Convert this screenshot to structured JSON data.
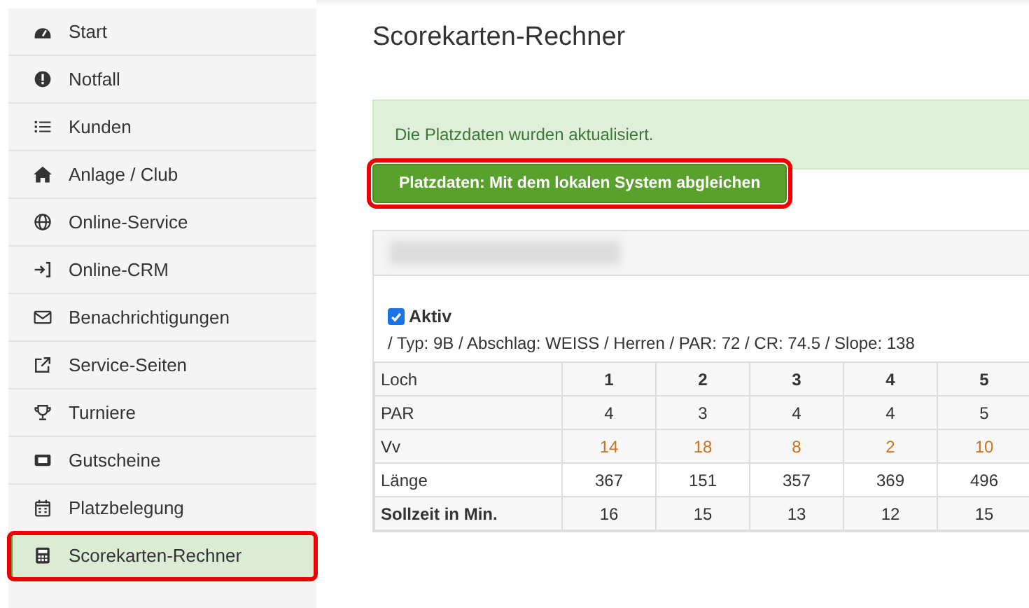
{
  "sidebar": {
    "items": [
      {
        "label": "Start",
        "kind": "dashboard",
        "selected": false,
        "highlighted": false
      },
      {
        "label": "Notfall",
        "kind": "alert",
        "selected": false,
        "highlighted": false
      },
      {
        "label": "Kunden",
        "kind": "list",
        "selected": false,
        "highlighted": false
      },
      {
        "label": "Anlage / Club",
        "kind": "home",
        "selected": false,
        "highlighted": false
      },
      {
        "label": "Online-Service",
        "kind": "globe",
        "selected": false,
        "highlighted": false
      },
      {
        "label": "Online-CRM",
        "kind": "login",
        "selected": false,
        "highlighted": false
      },
      {
        "label": "Benachrichtigungen",
        "kind": "mail",
        "selected": false,
        "highlighted": false
      },
      {
        "label": "Service-Seiten",
        "kind": "external",
        "selected": false,
        "highlighted": false
      },
      {
        "label": "Turniere",
        "kind": "trophy",
        "selected": false,
        "highlighted": false
      },
      {
        "label": "Gutscheine",
        "kind": "ticket",
        "selected": false,
        "highlighted": false
      },
      {
        "label": "Platzbelegung",
        "kind": "calendar",
        "selected": false,
        "highlighted": false
      },
      {
        "label": "Scorekarten-Rechner",
        "kind": "calculator",
        "selected": true,
        "highlighted": true
      }
    ]
  },
  "page_title": "Scorekarten-Rechner",
  "alert": "Die Platzdaten wurden aktualisiert.",
  "sync_button": {
    "label": "Platzdaten: Mit dem lokalen System abgleichen",
    "highlighted": true
  },
  "course": {
    "active": {
      "label": "Aktiv",
      "checked": true
    },
    "details": "/ Typ: 9B / Abschlag: WEISS / Herren / PAR: 72 / CR: 74.5 / Slope: 138",
    "table": {
      "rows": [
        {
          "kind": "header",
          "label": "Loch",
          "cells": [
            "1",
            "2",
            "3",
            "4",
            "5"
          ]
        },
        {
          "kind": "plain",
          "label": "PAR",
          "cells": [
            "4",
            "3",
            "4",
            "4",
            "5"
          ]
        },
        {
          "kind": "accent",
          "label": "Vv",
          "cells": [
            "14",
            "18",
            "8",
            "2",
            "10"
          ]
        },
        {
          "kind": "plain",
          "label": "Länge",
          "cells": [
            "367",
            "151",
            "357",
            "369",
            "496"
          ]
        },
        {
          "kind": "bold",
          "label": "Sollzeit in Min.",
          "cells": [
            "16",
            "15",
            "13",
            "12",
            "15"
          ]
        }
      ]
    }
  }
}
